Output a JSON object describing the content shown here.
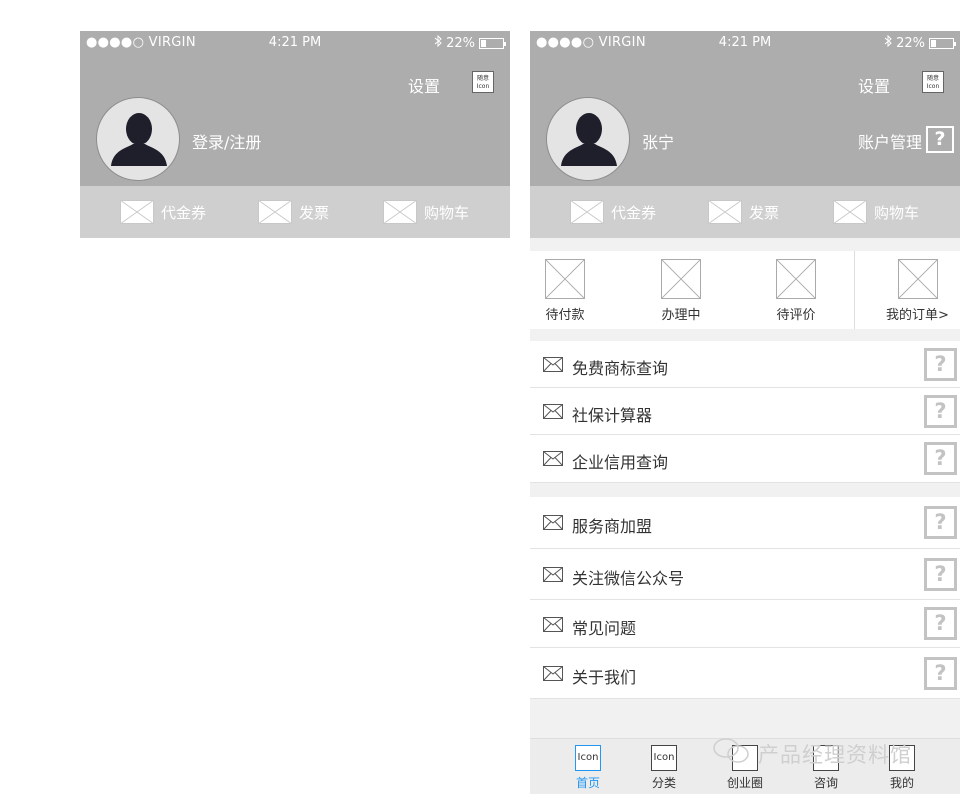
{
  "left_screen": {
    "status": {
      "carrier": "●●●●○ VIRGIN",
      "time": "4:21 PM",
      "battery": "22%"
    },
    "header": {
      "settings_label": "设置",
      "placeholder_icon_label": "随意\nIcon",
      "username": "登录/注册"
    },
    "shortcuts": [
      "代金券",
      "发票",
      "购物车"
    ]
  },
  "right_screen": {
    "status": {
      "carrier": "●●●●○ VIRGIN",
      "time": "4:21 PM",
      "battery": "22%"
    },
    "header": {
      "settings_label": "设置",
      "placeholder_icon_label": "随意\nIcon",
      "username": "张宁",
      "account_label": "账户管理",
      "question_mark": "?"
    },
    "shortcuts": [
      "代金券",
      "发票",
      "购物车"
    ],
    "orders": [
      "待付款",
      "办理中",
      "待评价",
      "我的订单>"
    ],
    "menu_group_1": [
      "免费商标查询",
      "社保计算器",
      "企业信用查询"
    ],
    "menu_group_2": [
      "服务商加盟",
      "关注微信公众号",
      "常见问题",
      "关于我们"
    ],
    "question_mark": "?",
    "tabs": [
      {
        "label": "首页",
        "icon_text": "Icon",
        "active": true
      },
      {
        "label": "分类",
        "icon_text": "Icon",
        "active": false
      },
      {
        "label": "创业圈",
        "icon_text": "",
        "active": false
      },
      {
        "label": "咨询",
        "icon_text": "",
        "active": false
      },
      {
        "label": "我的",
        "icon_text": "",
        "active": false
      }
    ],
    "active_tab_color": "#2196f3"
  },
  "watermark": "产品经理资料馆"
}
